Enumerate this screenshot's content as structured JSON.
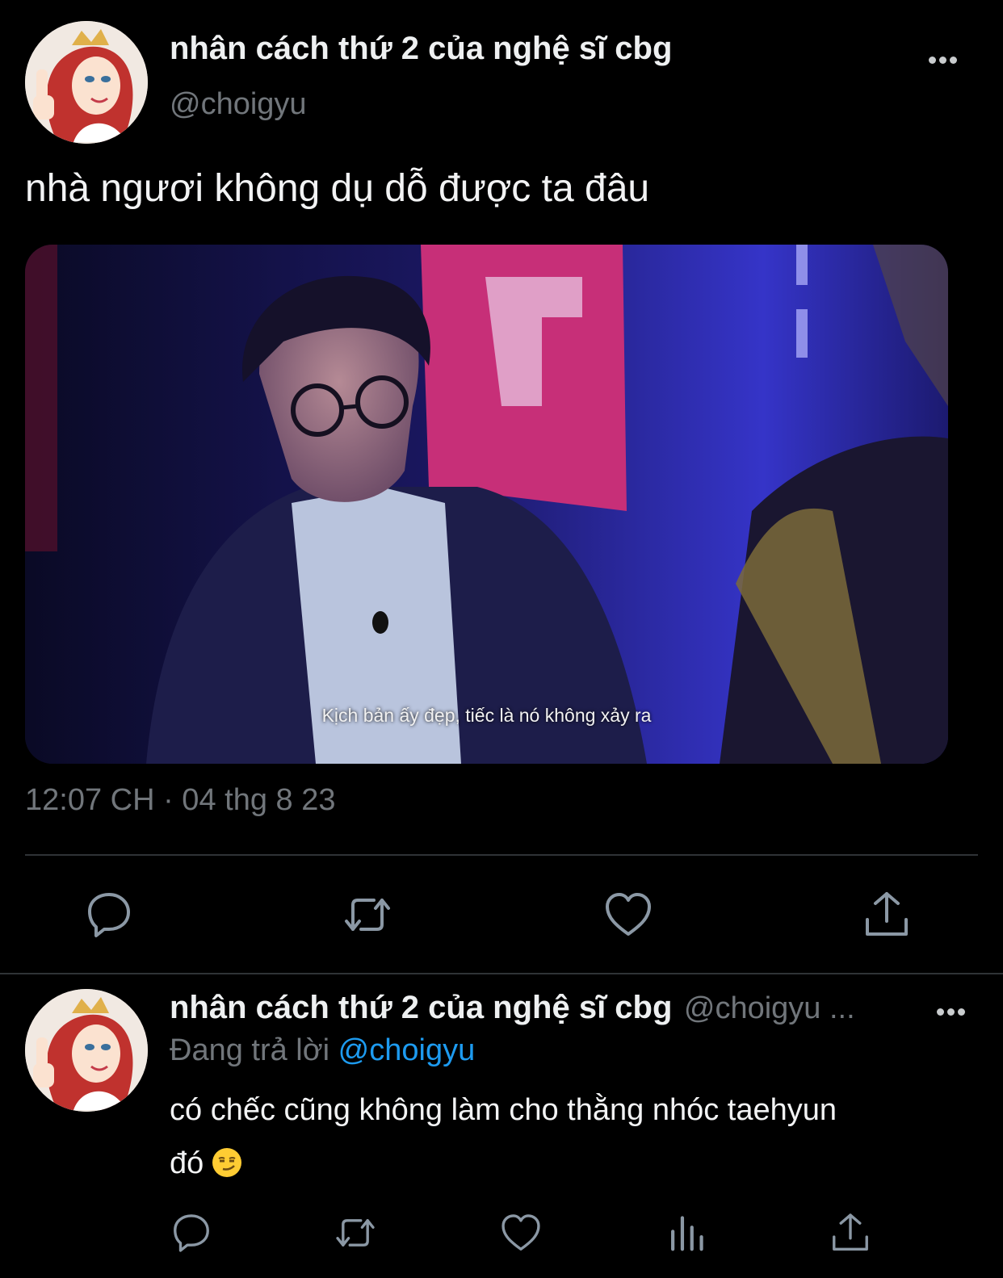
{
  "tweet": {
    "display_name": "nhân cách thứ 2 của nghệ sĩ cbg",
    "handle": "@choigyu",
    "text": "nhà ngươi không dụ dỗ được ta đâu",
    "media_caption": "Kịch bản ấy đẹp, tiếc là nó không xảy ra",
    "timestamp": "12:07 CH · 04 thg 8 23",
    "actions": [
      "reply-icon",
      "retweet-icon",
      "like-icon",
      "share-icon"
    ]
  },
  "reply": {
    "display_name": "nhân cách thứ 2 của nghệ sĩ cbg",
    "handle": "@choigyu ...",
    "replying_prefix": "Đang trả lời",
    "replying_to": "@choigyu",
    "text_line1": "có chếc cũng không làm cho thằng nhóc taehyun",
    "text_line2": "đó",
    "emoji": "smirking-face",
    "actions": [
      "reply-icon",
      "retweet-icon",
      "like-icon",
      "views-icon",
      "share-icon"
    ]
  },
  "colors": {
    "background": "#000000",
    "muted": "#71767b",
    "mention": "#1d9bf0",
    "divider": "#2f3336"
  }
}
